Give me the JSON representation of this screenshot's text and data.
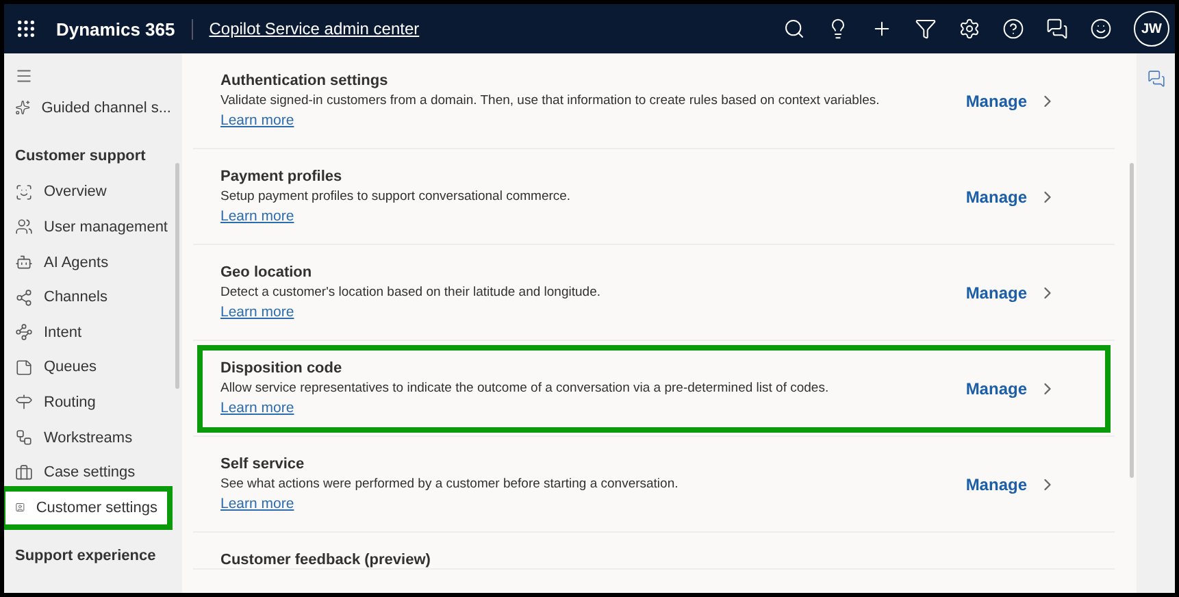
{
  "top_bar": {
    "app_name": "Dynamics 365",
    "area_name": "Copilot Service admin center",
    "user_initials": "JW"
  },
  "sidebar": {
    "top_items": [
      {
        "label": "Guided channel s...",
        "selected": false
      }
    ],
    "sections": [
      {
        "title": "Customer support",
        "items": [
          {
            "label": "Overview",
            "selected": false,
            "highlighted": false
          },
          {
            "label": "User management",
            "selected": false,
            "highlighted": false
          },
          {
            "label": "AI Agents",
            "selected": false,
            "highlighted": false
          },
          {
            "label": "Channels",
            "selected": false,
            "highlighted": false
          },
          {
            "label": "Intent",
            "selected": false,
            "highlighted": false
          },
          {
            "label": "Queues",
            "selected": false,
            "highlighted": false
          },
          {
            "label": "Routing",
            "selected": false,
            "highlighted": false
          },
          {
            "label": "Workstreams",
            "selected": false,
            "highlighted": false
          },
          {
            "label": "Case settings",
            "selected": false,
            "highlighted": false
          },
          {
            "label": "Customer settings",
            "selected": true,
            "highlighted": true
          }
        ]
      },
      {
        "title": "Support experience"
      }
    ]
  },
  "settings": [
    {
      "title": "Authentication settings",
      "description": "Validate signed-in customers from a domain. Then, use that information to create rules based on context variables.",
      "link": "Learn more",
      "action": "Manage",
      "highlighted": false
    },
    {
      "title": "Payment profiles",
      "description": "Setup payment profiles to support conversational commerce.",
      "link": "Learn more",
      "action": "Manage",
      "highlighted": false
    },
    {
      "title": "Geo location",
      "description": "Detect a customer's location based on their latitude and longitude.",
      "link": "Learn more",
      "action": "Manage",
      "highlighted": false
    },
    {
      "title": "Disposition code",
      "description": "Allow service representatives to indicate the outcome of a conversation via a pre-determined list of codes.",
      "link": "Learn more",
      "action": "Manage",
      "highlighted": true
    },
    {
      "title": "Self service",
      "description": "See what actions were performed by a customer before starting a conversation.",
      "link": "Learn more",
      "action": "Manage",
      "highlighted": false
    },
    {
      "title": "Customer feedback (preview)"
    }
  ]
}
